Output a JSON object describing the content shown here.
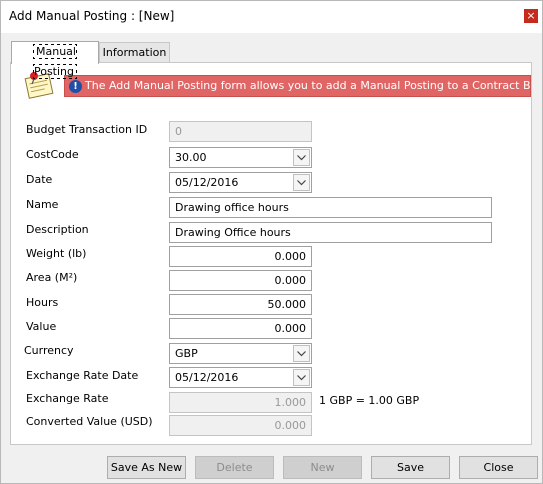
{
  "window": {
    "title": "Add Manual Posting : [New]",
    "close_glyph": "×"
  },
  "tabs": [
    {
      "label": "Manual Posting",
      "active": true
    },
    {
      "label": "Information",
      "active": false
    }
  ],
  "banner": {
    "icon": "exclamation-icon",
    "text": "The Add Manual Posting form allows you to add a Manual Posting to a Contract Budget.",
    "color": "#e06666"
  },
  "form": {
    "budget_transaction_id": {
      "label": "Budget Transaction ID",
      "value": "0"
    },
    "cost_code": {
      "label": "CostCode",
      "value": "30.00"
    },
    "date": {
      "label": "Date",
      "value": "05/12/2016"
    },
    "name": {
      "label": "Name",
      "value": "Drawing office hours"
    },
    "description": {
      "label": "Description",
      "value": "Drawing Office hours"
    },
    "weight": {
      "label": "Weight (lb)",
      "value": "0.000"
    },
    "area": {
      "label": "Area (M²)",
      "value": "0.000"
    },
    "hours": {
      "label": "Hours",
      "value": "50.000"
    },
    "value": {
      "label": "Value",
      "value": "0.000"
    },
    "currency": {
      "label": "Currency",
      "value": "GBP"
    },
    "exchange_rate_date": {
      "label": "Exchange Rate Date",
      "value": "05/12/2016"
    },
    "exchange_rate": {
      "label": "Exchange Rate",
      "value": "1.000",
      "conversion_text": "1 GBP = 1.00  GBP"
    },
    "converted_value": {
      "label": "Converted Value (USD)",
      "value": "0.000"
    }
  },
  "buttons": {
    "save_as_new": "Save As New",
    "delete": "Delete",
    "new": "New",
    "save": "Save",
    "close": "Close"
  }
}
